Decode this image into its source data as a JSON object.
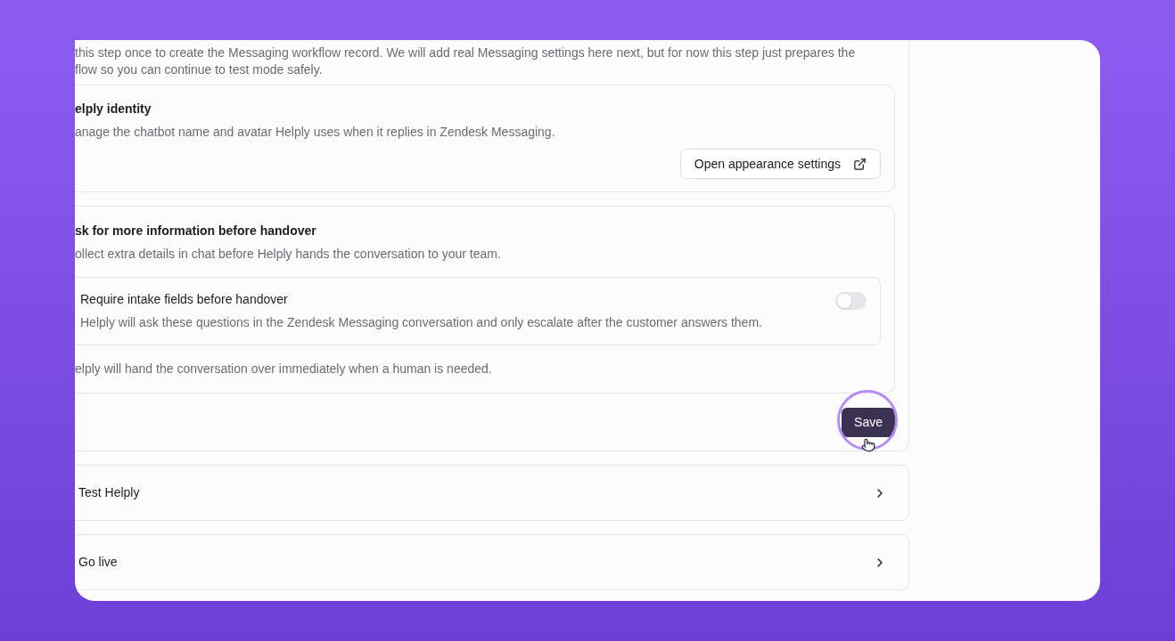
{
  "intro": "this step once to create the Messaging workflow record. We will add real Messaging settings here next, but for now this step just prepares the",
  "intro_line_2": "flow so you can continue to test mode safely.",
  "identity": {
    "title": "elply identity",
    "description": "anage the chatbot name and avatar Helply uses when it replies in Zendesk Messaging.",
    "button": "Open appearance settings"
  },
  "handover": {
    "title": "sk for more information before handover",
    "description": "ollect extra details in chat before Helply hands the conversation to your team.",
    "option": {
      "title": "Require intake fields before handover",
      "description": "Helply will ask these questions in the Zendesk Messaging conversation and only escalate after the customer answers them.",
      "on": false
    },
    "note": "elply will hand the conversation over immediately when a human is needed."
  },
  "save_button": "Save",
  "steps": [
    {
      "label": "Test Helply"
    },
    {
      "label": "Go live"
    }
  ]
}
